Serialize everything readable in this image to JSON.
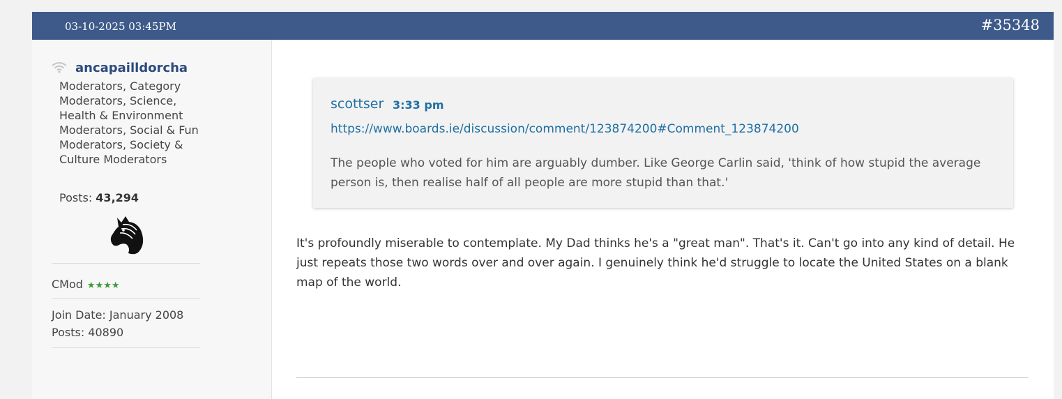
{
  "post": {
    "date": "03-10-2025 03:45PM",
    "number": "#35348"
  },
  "author": {
    "username": "ancapailldorcha",
    "roles": "Moderators, Category Moderators, Science, Health & Environment Moderators, Social & Fun Moderators, Society & Culture Moderators",
    "posts_label": "Posts: ",
    "posts_count": "43,294",
    "rank": "CMod",
    "rank_stars": "★★★★",
    "join_date": "Join Date: January 2008",
    "posts": "Posts: 40890",
    "icons": {
      "status": "wifi-icon",
      "avatar": "horse-head-icon"
    }
  },
  "quote": {
    "author": "scottser",
    "time": "3:33 pm",
    "link": "https://www.boards.ie/discussion/comment/123874200#Comment_123874200",
    "text": "The people who voted for him are arguably dumber. Like George Carlin said, 'think of how stupid the average person is, then realise half of all people are more stupid than that.'"
  },
  "body": {
    "text": "It's profoundly miserable to contemplate. My Dad thinks he's a \"great man\". That's it. Can't go into any kind of detail. He just repeats those two words over and over again. I genuinely think he'd struggle to locate the United States on a blank map of the world."
  },
  "colors": {
    "header": "#3d5a8a",
    "username": "#2b4a7e",
    "link": "#1f6fa3",
    "stars": "#3a9a3a"
  }
}
